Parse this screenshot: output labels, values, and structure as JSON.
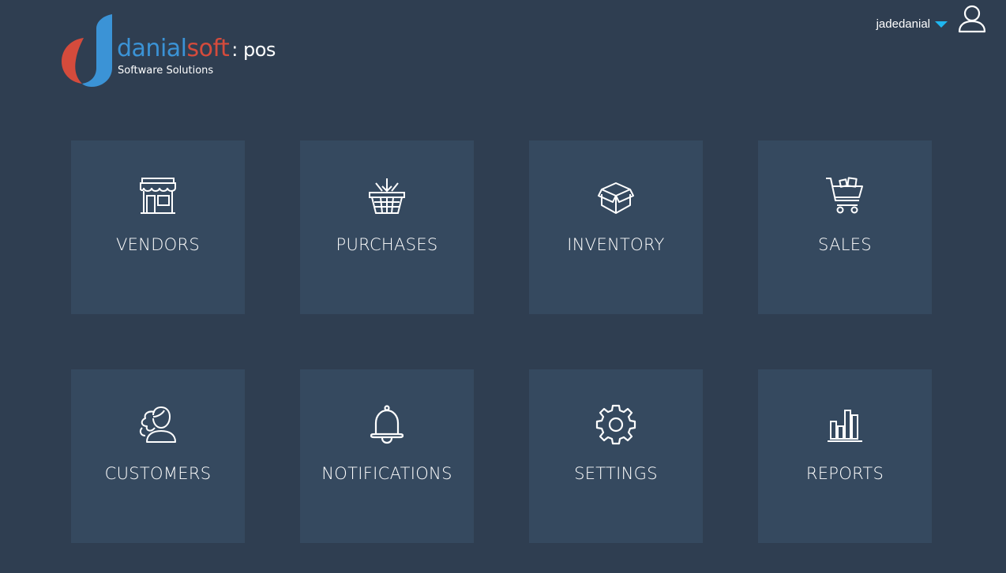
{
  "brand": {
    "name_part1": "danial",
    "name_part2": "soft",
    "suffix": ": pos",
    "tagline": "Software Solutions",
    "colors": {
      "blue": "#3b93d6",
      "red": "#d44b3c"
    }
  },
  "user": {
    "username": "jadedanial",
    "caret_color": "#1fb6f0",
    "avatar_icon": "user-icon"
  },
  "tiles": [
    {
      "label": "VENDORS",
      "icon": "storefront-icon"
    },
    {
      "label": "PURCHASES",
      "icon": "basket-icon"
    },
    {
      "label": "INVENTORY",
      "icon": "box-icon"
    },
    {
      "label": "SALES",
      "icon": "cart-icon"
    },
    {
      "label": "CUSTOMERS",
      "icon": "customer-icon"
    },
    {
      "label": "NOTIFICATIONS",
      "icon": "bell-icon"
    },
    {
      "label": "SETTINGS",
      "icon": "gear-icon"
    },
    {
      "label": "REPORTS",
      "icon": "bar-chart-icon"
    }
  ],
  "theme": {
    "background": "#2f3e51",
    "tile_background": "#35495f"
  }
}
